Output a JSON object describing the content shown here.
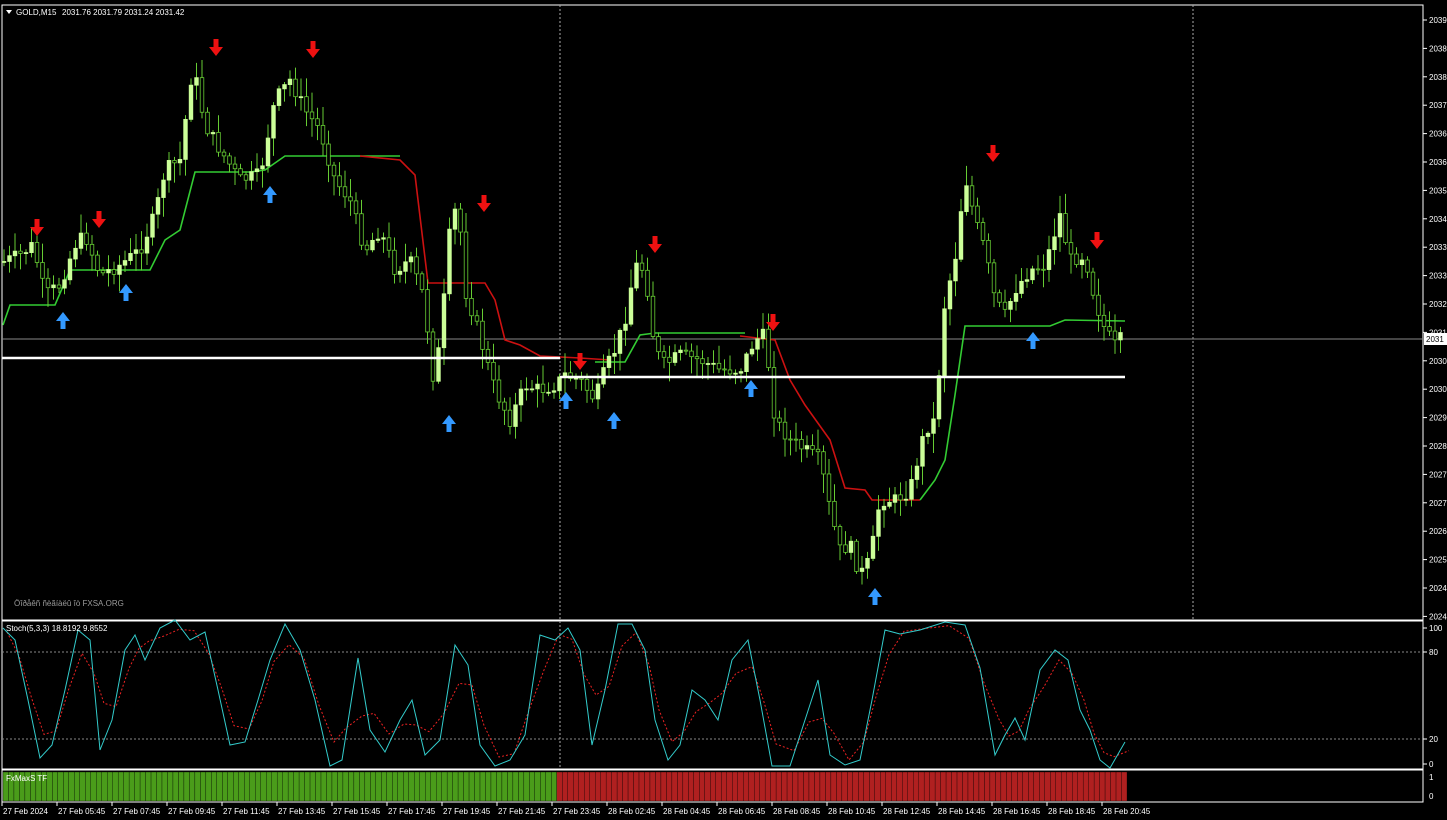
{
  "header": {
    "symbol": "GOLD,M15",
    "ohlc": "2031.76 2031.79 2031.24 2031.42"
  },
  "watermark": "Öîðåêñ ñèãíàëû îò FXSA.ORG",
  "stoch_label": "Stoch(5,3,3) 18.8192 9.8552",
  "tf_label": "FxMaxS TF",
  "current_price_label": "2031",
  "colors": {
    "bg": "#000000",
    "bull_candle": "#ccff99",
    "wick": "#66cc33",
    "trail_up": "#33cc33",
    "trail_down": "#cc1111",
    "arrow_up": "#3399ff",
    "arrow_down": "#ee1111",
    "stoch_main": "#33cccc",
    "stoch_signal": "#ee2222",
    "tf_green": "#4a9c1a",
    "tf_red": "#b02020"
  },
  "chart_data": {
    "type": "candlestick",
    "price_axis": {
      "tick_labels": [
        "2039",
        "2038",
        "2038",
        "2037",
        "2036",
        "2036",
        "2035",
        "2034",
        "2033",
        "2033",
        "2032",
        "2031",
        "2030",
        "2030",
        "2029",
        "2028",
        "2027",
        "2027",
        "2026",
        "2025",
        "2024",
        "2024"
      ]
    },
    "time_axis": {
      "tick_labels": [
        "27 Feb 2024",
        "27 Feb 05:45",
        "27 Feb 07:45",
        "27 Feb 09:45",
        "27 Feb 11:45",
        "27 Feb 13:45",
        "27 Feb 15:45",
        "27 Feb 17:45",
        "27 Feb 19:45",
        "27 Feb 21:45",
        "27 Feb 23:45",
        "28 Feb 02:45",
        "28 Feb 04:45",
        "28 Feb 06:45",
        "28 Feb 08:45",
        "28 Feb 10:45",
        "28 Feb 12:45",
        "28 Feb 14:45",
        "28 Feb 16:45",
        "28 Feb 18:45",
        "28 Feb 20:45"
      ]
    },
    "stoch_axis": {
      "tick_labels": [
        "100",
        "80",
        "20",
        "0"
      ],
      "levels": [
        80,
        20
      ]
    },
    "tf_axis": {
      "tick_labels": [
        "1",
        "0"
      ]
    },
    "tf_bars": {
      "green_count": 101,
      "red_count": 104
    }
  }
}
